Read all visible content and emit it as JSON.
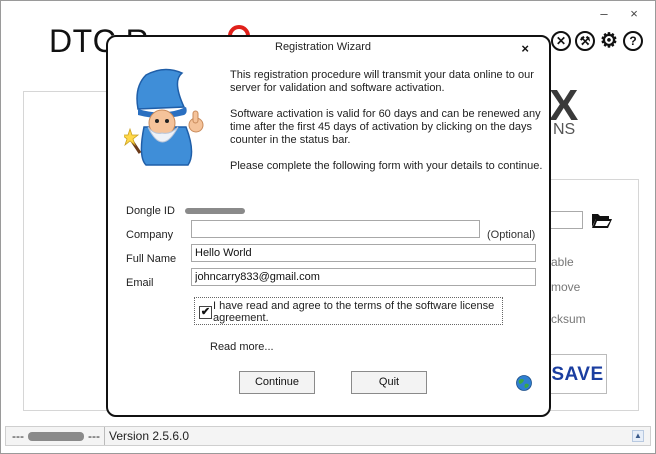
{
  "app": {
    "title": "DTC R",
    "brand_fragment": "X",
    "brand_sub": "NS",
    "options": [
      "able",
      "move",
      "cksum"
    ],
    "save_label": "SAVE",
    "status": {
      "left": "---",
      "mid": "---",
      "version": "Version 2.5.6.0"
    },
    "window_controls": {
      "minimize": "–",
      "close": "×"
    },
    "tool_icons": [
      "wrench-screwdriver-icon",
      "tools-icon",
      "gear-icon",
      "help-icon"
    ]
  },
  "dialog": {
    "title": "Registration Wizard",
    "close": "×",
    "intro": [
      "This registration procedure will transmit your data online to our server for validation and software activation.",
      "Software activation is valid for 60 days and can be renewed any time after the first 45 days of activation by clicking on the days counter in the status bar.",
      "Please complete the following form with your details to continue."
    ],
    "fields": {
      "dongle_label": "Dongle ID",
      "company_label": "Company",
      "company_value": "",
      "optional": "(Optional)",
      "fullname_label": "Full Name",
      "fullname_value": "Hello World",
      "email_label": "Email",
      "email_value": "johncarry833@gmail.com"
    },
    "agree": {
      "checked": true,
      "check_glyph": "✔",
      "text": "I have read and agree to the terms of the software license agreement."
    },
    "read_more": "Read more...",
    "continue_label": "Continue",
    "quit_label": "Quit",
    "accent_colors": {
      "save": "#1b3ea0",
      "logo_ring": "#e0201a"
    }
  }
}
